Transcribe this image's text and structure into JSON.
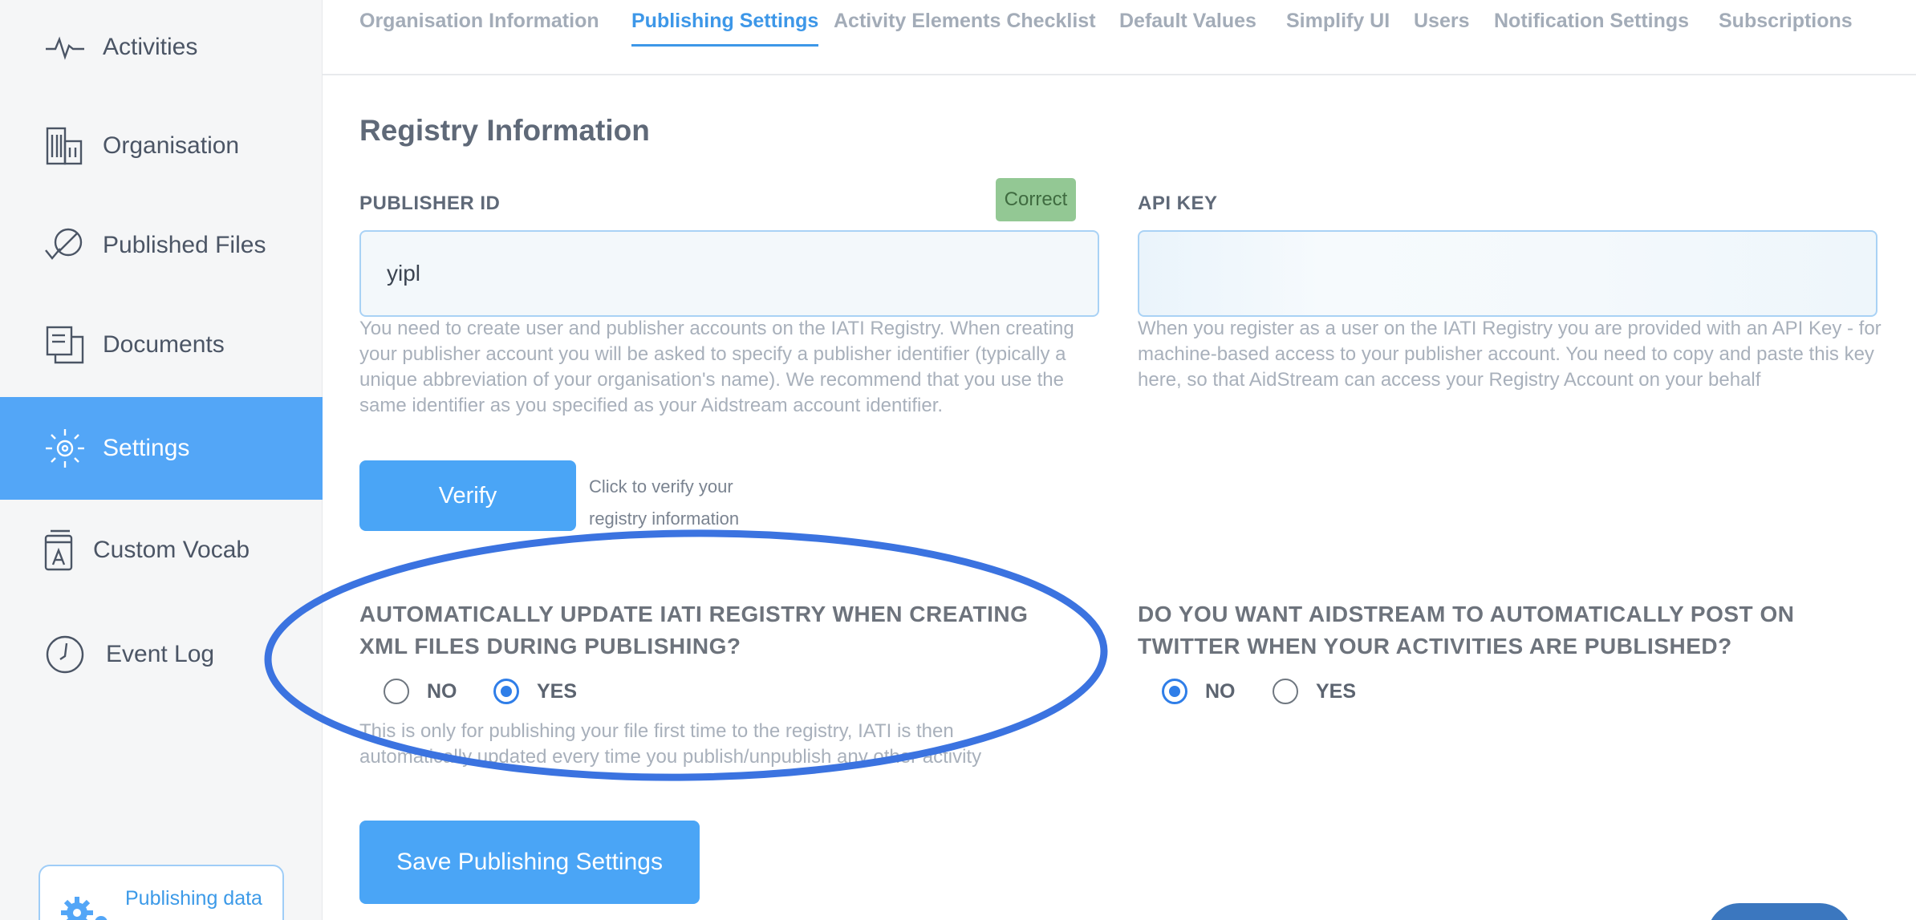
{
  "sidebar": {
    "items": [
      {
        "label": "Activities",
        "icon": "activity-pulse-icon"
      },
      {
        "label": "Organisation",
        "icon": "building-icon"
      },
      {
        "label": "Published Files",
        "icon": "published-files-icon"
      },
      {
        "label": "Documents",
        "icon": "documents-icon"
      },
      {
        "label": "Settings",
        "icon": "settings-sun-icon",
        "active": true
      },
      {
        "label": "Custom Vocab",
        "icon": "vocab-book-icon"
      },
      {
        "label": "Event Log",
        "icon": "clock-icon"
      }
    ],
    "publishing_data": {
      "label": "Publishing data",
      "icon": "gears-icon"
    }
  },
  "tabs": [
    {
      "label": "Organisation Information"
    },
    {
      "label": "Publishing Settings",
      "active": true
    },
    {
      "label": "Activity Elements Checklist"
    },
    {
      "label": "Default Values"
    },
    {
      "label": "Simplify UI"
    },
    {
      "label": "Users"
    },
    {
      "label": "Notification Settings"
    },
    {
      "label": "Subscriptions"
    }
  ],
  "registry": {
    "title": "Registry Information",
    "publisher_id": {
      "label": "PUBLISHER ID",
      "value": "yipl",
      "status": "Correct",
      "help": "You need to create user and publisher accounts on the IATI Registry. When creating your publisher account you will be asked to specify a publisher identifier (typically a unique abbreviation of your organisation's name). We recommend that you use the same identifier as you specified as your Aidstream account identifier."
    },
    "api_key": {
      "label": "API KEY",
      "help": "When you register as a user on the IATI Registry you are provided with an API Key - for machine-based access to your publisher account. You need to copy and paste this key here, so that AidStream can access your Registry Account on your behalf"
    },
    "verify_label": "Verify",
    "verify_hint": "Click to verify your registry information"
  },
  "auto_update": {
    "question": "AUTOMATICALLY UPDATE IATI REGISTRY WHEN CREATING XML FILES DURING PUBLISHING?",
    "options": [
      {
        "label": "NO",
        "checked": false
      },
      {
        "label": "YES",
        "checked": true
      }
    ],
    "help": "This is only for publishing your file first time to the registry, IATI is then automatically updated every time you publish/unpublish any other activity"
  },
  "twitter": {
    "question": "DO YOU WANT AIDSTREAM TO AUTOMATICALLY POST ON TWITTER WHEN YOUR ACTIVITIES ARE PUBLISHED?",
    "options": [
      {
        "label": "NO",
        "checked": true
      },
      {
        "label": "YES",
        "checked": false
      }
    ]
  },
  "save_label": "Save Publishing Settings",
  "colors": {
    "accent": "#4aa5f6",
    "active_tab": "#3d97e8",
    "success_badge": "#93c894",
    "annotation_ellipse": "#3b73e0"
  }
}
